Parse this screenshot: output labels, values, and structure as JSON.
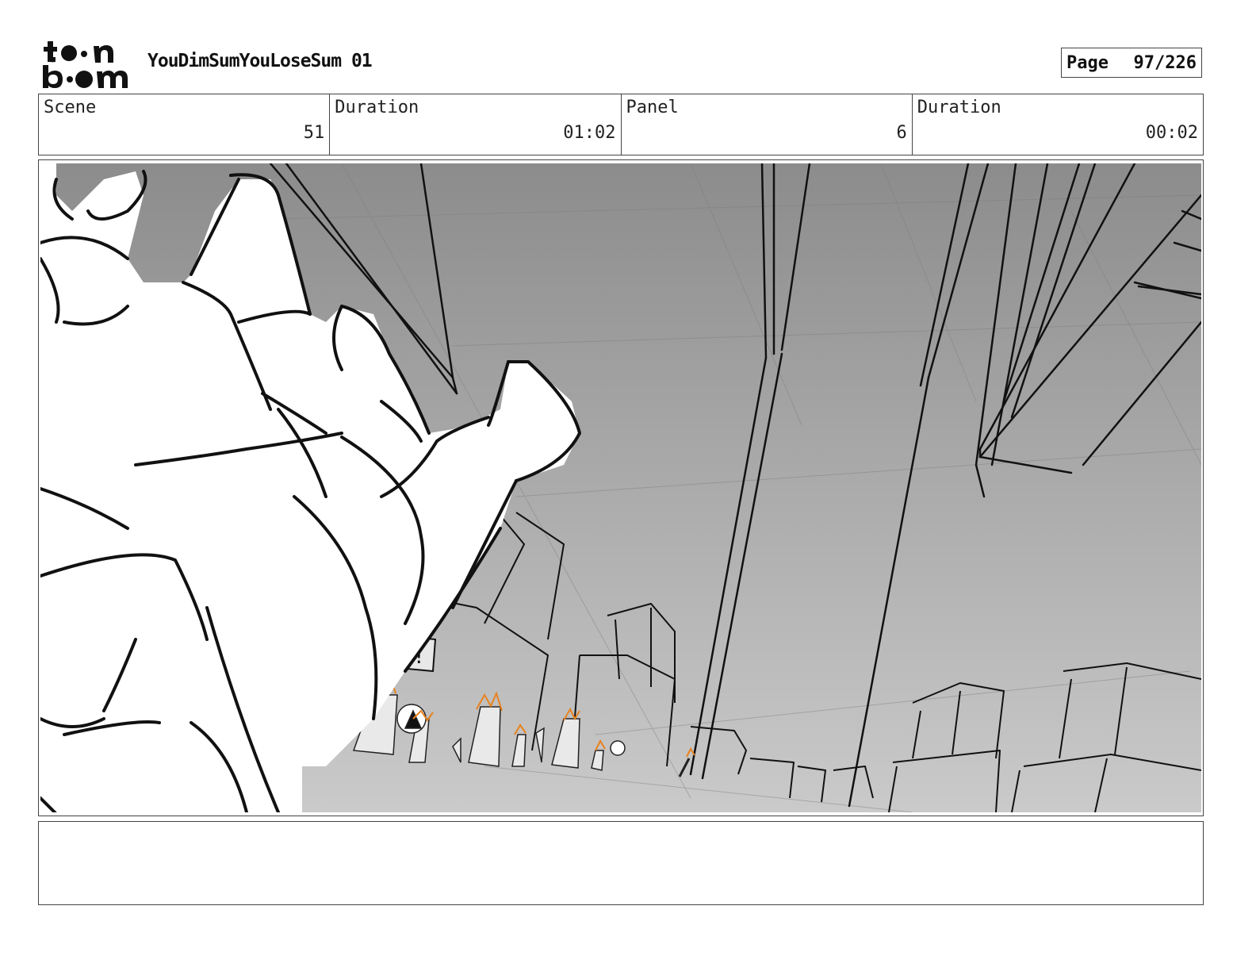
{
  "header": {
    "logo_name": "toon-boom-logo",
    "project_title": "YouDimSumYouLoseSum 01",
    "page_label": "Page",
    "page_number": "97/226"
  },
  "info": {
    "scene_label": "Scene",
    "scene_value": "51",
    "scene_duration_label": "Duration",
    "scene_duration_value": "01:02",
    "panel_label": "Panel",
    "panel_value": "6",
    "panel_duration_label": "Duration",
    "panel_duration_value": "00:02"
  },
  "sign_text": "R!",
  "colors": {
    "ink": "#111111",
    "accent": "#e8821e",
    "sky_top": "#8f8f8f",
    "sky_bottom": "#c9c9c9"
  },
  "notes": {
    "text": ""
  }
}
